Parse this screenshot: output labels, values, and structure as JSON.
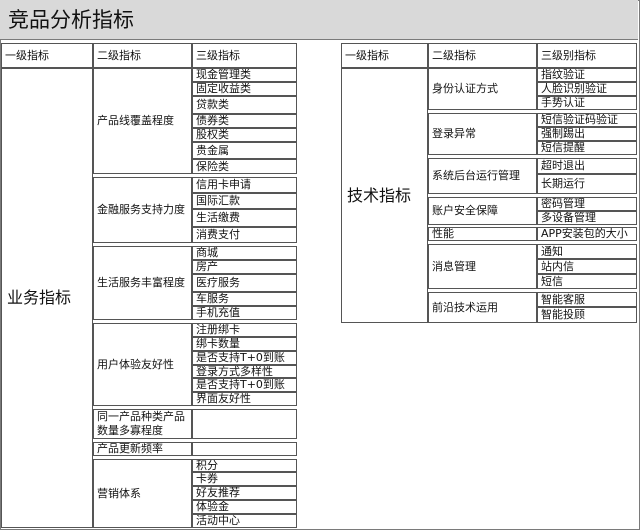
{
  "title": "竞品分析指标",
  "headers": {
    "level1": "一级指标",
    "level2": "二级指标",
    "level3_left": "三级指标",
    "level3_right": "三级别指标"
  },
  "business": {
    "label": "业务指标",
    "groups": [
      {
        "name": "产品线覆盖程度",
        "items": [
          "现金管理类",
          "固定收益类",
          "贷款类",
          "债券类",
          "股权类",
          "贵金属",
          "保险类"
        ]
      },
      {
        "name": "金融服务支持力度",
        "items": [
          "信用卡申请",
          "国际汇款",
          "生活缴费",
          "消费支付"
        ]
      },
      {
        "name": "生活服务丰富程度",
        "items": [
          "商城",
          "房产",
          "医疗服务",
          "车服务",
          "手机充值"
        ]
      },
      {
        "name": "用户体验友好性",
        "items": [
          "注册绑卡",
          "绑卡数量",
          "是否支持T+0到账",
          "登录方式多样性",
          "是否支持T+0到账",
          "界面友好性"
        ]
      },
      {
        "name": "同一产品种类产品数量多寡程度",
        "items": []
      },
      {
        "name": "产品更新频率",
        "items": []
      },
      {
        "name": "营销体系",
        "items": [
          "积分",
          "卡券",
          "好友推荐",
          "体验金",
          "活动中心"
        ]
      }
    ]
  },
  "tech": {
    "label": "技术指标",
    "groups": [
      {
        "name": "身份认证方式",
        "items": [
          "指纹验证",
          "人脸识别验证",
          "手势认证"
        ]
      },
      {
        "name": "登录异常",
        "items": [
          "短信验证码验证",
          "强制踢出",
          "短信提醒"
        ]
      },
      {
        "name": "系统后台运行管理",
        "items": [
          "超时退出",
          "长期运行"
        ]
      },
      {
        "name": "账户安全保障",
        "items": [
          "密码管理",
          "多设备管理"
        ]
      },
      {
        "name": "性能",
        "items": [
          "APP安装包的大小"
        ]
      },
      {
        "name": "消息管理",
        "items": [
          "通知",
          "站内信",
          "短信"
        ]
      },
      {
        "name": "前沿技术运用",
        "items": [
          "智能客服",
          "智能投顾"
        ]
      }
    ]
  }
}
